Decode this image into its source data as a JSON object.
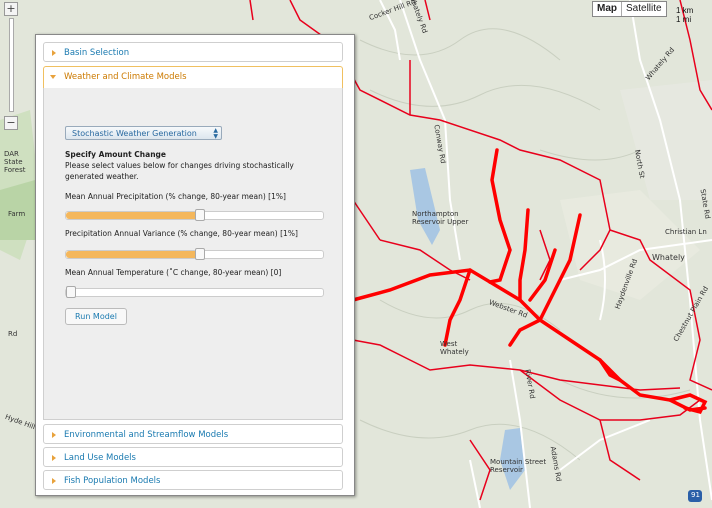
{
  "map": {
    "labels": {
      "whately_rd_top": "Whately Rd",
      "whately_rd_2": "Whately Rd",
      "conway_rd": "Conway Rd",
      "north_st": "North St",
      "state_rd": "State Rd",
      "christian_ln": "Christian Ln",
      "whately": "Whately",
      "reservoir": "Northampton Reservoir Upper",
      "chestnut_plain": "Chestnut Plain Rd",
      "mountain_street": "Mountain Street Reservoir",
      "west_whately": "West Whately",
      "webster_rd": "Webster Rd",
      "forest": "DAR State Forest",
      "farm": "Farm",
      "rd_left": "Rd",
      "hyde_hill": "Hyde Hill Rd",
      "adams_rd": "Adams Rd",
      "haydenville": "Haydenville Rd",
      "river_rd": "River Rd",
      "cocker_hill": "Cocker Hill Rd",
      "interstate": "91"
    },
    "colors": {
      "boundary": "#e8001c",
      "stream": "#ff0000",
      "terrain": "#dfe4d6"
    }
  },
  "zoom": {
    "in_label": "+",
    "out_label": "−"
  },
  "map_type": {
    "map_label": "Map",
    "satellite_label": "Satellite",
    "selected": "Map"
  },
  "scale": {
    "top": "1 km",
    "bottom": "1 mi"
  },
  "panel": {
    "sections": [
      {
        "label": "Basin Selection",
        "expanded": false
      },
      {
        "label": "Weather and Climate Models",
        "expanded": true
      },
      {
        "label": "Environmental and Streamflow Models",
        "expanded": false
      },
      {
        "label": "Land Use Models",
        "expanded": false
      },
      {
        "label": "Fish Population Models",
        "expanded": false
      }
    ],
    "weather": {
      "model_select": "Stochastic Weather Generation",
      "heading": "Specify Amount Change",
      "instructions_1": "Please select values below for changes driving stochastically",
      "instructions_2": "generated weather.",
      "sliders": [
        {
          "label": "Mean Annual Precipitation (% change, 80-year mean) [1%]",
          "fraction": 0.52
        },
        {
          "label": "Precipitation Annual Variance (% change, 80-year mean) [1%]",
          "fraction": 0.52
        },
        {
          "label": "Mean Annual Temperature (˚C change, 80-year mean) [0]",
          "fraction": 0.0
        }
      ],
      "run_label": "Run Model"
    }
  }
}
